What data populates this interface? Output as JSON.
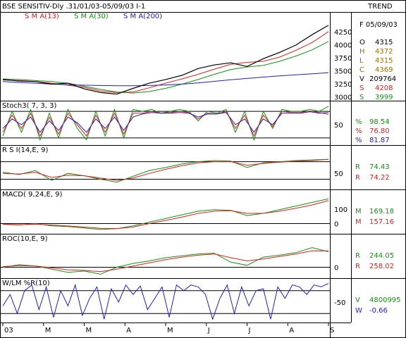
{
  "header": {
    "title": "BSE SENSITIV-Dly .31/01/03-05/09/03  I-1",
    "right_label": "TREND",
    "legend": [
      {
        "label": "S M A(13)",
        "color": "#e02020"
      },
      {
        "label": "S M A(30)",
        "color": "#159015"
      },
      {
        "label": "S M A(200)",
        "color": "#2020c0"
      }
    ]
  },
  "info_panel": {
    "date": "F 05/09/03",
    "rows": [
      {
        "key": "O",
        "value": "4315",
        "color": "#000000"
      },
      {
        "key": "H",
        "value": "4372",
        "color": "#a07000"
      },
      {
        "key": "L",
        "value": "4315",
        "color": "#a07000"
      },
      {
        "key": "C",
        "value": "4369",
        "color": "#a07000"
      },
      {
        "key": "V",
        "value": "209764",
        "color": "#000000"
      },
      {
        "key": "S",
        "value": "4208",
        "color": "#e02020"
      },
      {
        "key": "S",
        "value": "3999",
        "color": "#159015"
      }
    ]
  },
  "x_axis": {
    "labels": [
      "03",
      "M",
      "M",
      "A",
      "M",
      "J",
      "J",
      "A",
      "S"
    ]
  },
  "colors": {
    "price": "#000000",
    "sma13": "#e02020",
    "sma30": "#159015",
    "sma200": "#2020c0",
    "willr": "#2020c0"
  },
  "chart_data": [
    {
      "type": "line",
      "title": "BSE SENSITIV-Dly .31/01/03-05/09/03  I-1",
      "panel": "price",
      "ylim": [
        2950,
        4450
      ],
      "yticks": [
        "4250",
        "4000",
        "3750",
        "3500",
        "3250",
        "3000"
      ],
      "ytick_values": [
        4250,
        4000,
        3750,
        3500,
        3250,
        3000
      ],
      "series": [
        {
          "name": "S M A(13)",
          "color": "#e02020",
          "values": [
            3320,
            3310,
            3290,
            3260,
            3220,
            3180,
            3110,
            3080,
            3090,
            3170,
            3260,
            3340,
            3430,
            3530,
            3620,
            3660,
            3680,
            3760,
            3890,
            4040,
            4250
          ]
        },
        {
          "name": "S M A(30)",
          "color": "#159015",
          "values": [
            3340,
            3330,
            3310,
            3290,
            3260,
            3200,
            3140,
            3090,
            3070,
            3100,
            3160,
            3240,
            3330,
            3430,
            3520,
            3570,
            3600,
            3680,
            3780,
            3900,
            4060
          ]
        },
        {
          "name": "S M A(200)",
          "color": "#2020c0",
          "values": [
            3290,
            3270,
            3260,
            3240,
            3230,
            3220,
            3215,
            3210,
            3210,
            3215,
            3225,
            3240,
            3265,
            3295,
            3325,
            3350,
            3375,
            3400,
            3420,
            3440,
            3460
          ]
        },
        {
          "name": "price",
          "color": "#000000",
          "values": [
            3330,
            3300,
            3290,
            3240,
            3260,
            3150,
            3080,
            3050,
            3160,
            3260,
            3330,
            3410,
            3540,
            3610,
            3650,
            3580,
            3730,
            3850,
            3990,
            4190,
            4370
          ]
        }
      ],
      "readouts": {
        "O": 4315,
        "H": 4372,
        "L": 4315,
        "C": 4369,
        "V": 209764,
        "S13": 4208,
        "S30": 3999
      }
    },
    {
      "type": "line",
      "title": "Stoch3( 7, 3, 3)",
      "panel": "stoch",
      "ylim": [
        0,
        100
      ],
      "yticks": [
        "50"
      ],
      "ytick_values": [
        50
      ],
      "ref_lines": [
        15,
        85
      ],
      "series": [
        {
          "name": "%",
          "color": "#159015",
          "values": [
            20,
            85,
            30,
            90,
            10,
            80,
            15,
            90,
            40,
            10,
            85,
            20,
            90,
            15,
            90,
            85,
            90,
            80,
            85,
            90,
            85,
            60,
            85,
            80,
            90,
            30,
            85,
            10,
            85,
            40,
            90,
            85,
            85,
            90,
            85,
            98
          ]
        },
        {
          "name": "%",
          "color": "#e02020",
          "values": [
            30,
            75,
            40,
            80,
            20,
            70,
            25,
            80,
            50,
            20,
            75,
            30,
            80,
            25,
            80,
            80,
            85,
            80,
            82,
            85,
            82,
            65,
            80,
            78,
            85,
            40,
            75,
            20,
            75,
            45,
            85,
            82,
            82,
            86,
            82,
            77
          ]
        },
        {
          "name": "%",
          "color": "#2020c0",
          "values": [
            40,
            65,
            50,
            70,
            30,
            60,
            35,
            70,
            55,
            30,
            65,
            40,
            70,
            35,
            70,
            78,
            82,
            80,
            80,
            82,
            80,
            70,
            78,
            78,
            82,
            50,
            65,
            30,
            65,
            50,
            80,
            80,
            80,
            84,
            80,
            82
          ]
        }
      ],
      "readouts": [
        {
          "label": "%",
          "value": "98.54",
          "color": "#159015"
        },
        {
          "label": "%",
          "value": "76.80",
          "color": "#e02020"
        },
        {
          "label": "%",
          "value": "81.87",
          "color": "#2020c0"
        }
      ]
    },
    {
      "type": "line",
      "title": "R S I(14,E, 9)",
      "panel": "rsi",
      "ylim": [
        25,
        90
      ],
      "yticks": [
        "50"
      ],
      "ytick_values": [
        50
      ],
      "ref_lines": [
        40,
        70
      ],
      "series": [
        {
          "name": "R",
          "color": "#159015",
          "values": [
            52,
            48,
            55,
            38,
            50,
            46,
            40,
            35,
            45,
            55,
            60,
            66,
            70,
            72,
            71,
            60,
            68,
            70,
            72,
            73,
            74
          ]
        },
        {
          "name": "R",
          "color": "#e02020",
          "values": [
            50,
            49,
            52,
            43,
            47,
            46,
            42,
            38,
            42,
            50,
            57,
            63,
            68,
            70,
            70,
            64,
            67,
            69,
            71,
            72,
            74
          ]
        }
      ],
      "readouts": [
        {
          "label": "R",
          "value": "74.43",
          "color": "#159015"
        },
        {
          "label": "R",
          "value": "74.22",
          "color": "#e02020"
        }
      ]
    },
    {
      "type": "line",
      "title": "MACD( 9,24,E, 9)",
      "panel": "macd",
      "ylim": [
        -60,
        200
      ],
      "yticks": [
        "100",
        "0"
      ],
      "ytick_values": [
        100,
        0
      ],
      "ref_lines": [
        0
      ],
      "series": [
        {
          "name": "M",
          "color": "#159015",
          "values": [
            -5,
            -10,
            0,
            -15,
            -20,
            -30,
            -40,
            -35,
            -15,
            10,
            35,
            60,
            85,
            95,
            90,
            55,
            70,
            95,
            120,
            145,
            169
          ]
        },
        {
          "name": "M",
          "color": "#e02020",
          "values": [
            -3,
            -8,
            -4,
            -10,
            -16,
            -24,
            -32,
            -34,
            -24,
            0,
            22,
            45,
            70,
            85,
            88,
            70,
            70,
            85,
            105,
            128,
            157
          ]
        }
      ],
      "readouts": [
        {
          "label": "M",
          "value": "169.18",
          "color": "#159015"
        },
        {
          "label": "M",
          "value": "157.16",
          "color": "#e02020"
        }
      ]
    },
    {
      "type": "line",
      "title": "ROC(10,E, 9)",
      "panel": "roc",
      "ylim": [
        -150,
        450
      ],
      "yticks": [
        "0"
      ],
      "ytick_values": [
        0
      ],
      "ref_lines": [
        0
      ],
      "series": [
        {
          "name": "R",
          "color": "#159015",
          "values": [
            0,
            40,
            20,
            -30,
            -80,
            -60,
            -110,
            0,
            60,
            100,
            150,
            180,
            210,
            220,
            80,
            30,
            160,
            190,
            230,
            310,
            244
          ]
        },
        {
          "name": "R",
          "color": "#e02020",
          "values": [
            10,
            25,
            20,
            -10,
            -40,
            -50,
            -70,
            -30,
            20,
            70,
            120,
            160,
            190,
            210,
            150,
            100,
            130,
            170,
            210,
            260,
            258
          ]
        }
      ],
      "readouts": [
        {
          "label": "R",
          "value": "244.05",
          "color": "#159015"
        },
        {
          "label": "R",
          "value": "258.02",
          "color": "#e02020"
        }
      ]
    },
    {
      "type": "line",
      "title": "W/LM %R(10)",
      "panel": "willr",
      "ylim": [
        -100,
        0
      ],
      "yticks": [
        "-50"
      ],
      "ytick_values": [
        -50
      ],
      "ref_lines": [
        -20,
        -80
      ],
      "series": [
        {
          "name": "W",
          "color": "#2020c0",
          "values": [
            -60,
            -30,
            -80,
            -20,
            -5,
            -70,
            -10,
            -90,
            -20,
            -60,
            -5,
            -85,
            -40,
            -10,
            -95,
            -15,
            -50,
            -5,
            -30,
            -8,
            -70,
            -40,
            -10,
            -90,
            -5,
            -20,
            -5,
            -10,
            -30,
            -95,
            -40,
            -5,
            -80,
            -10,
            -60,
            -20,
            -15,
            -95,
            -10,
            -40,
            -5,
            -10,
            -30,
            -5,
            -10,
            -1
          ]
        }
      ],
      "readouts": [
        {
          "label": "V",
          "value": "4800995",
          "color": "#159015"
        },
        {
          "label": "W",
          "value": "-0.66",
          "color": "#2020c0"
        }
      ]
    }
  ]
}
